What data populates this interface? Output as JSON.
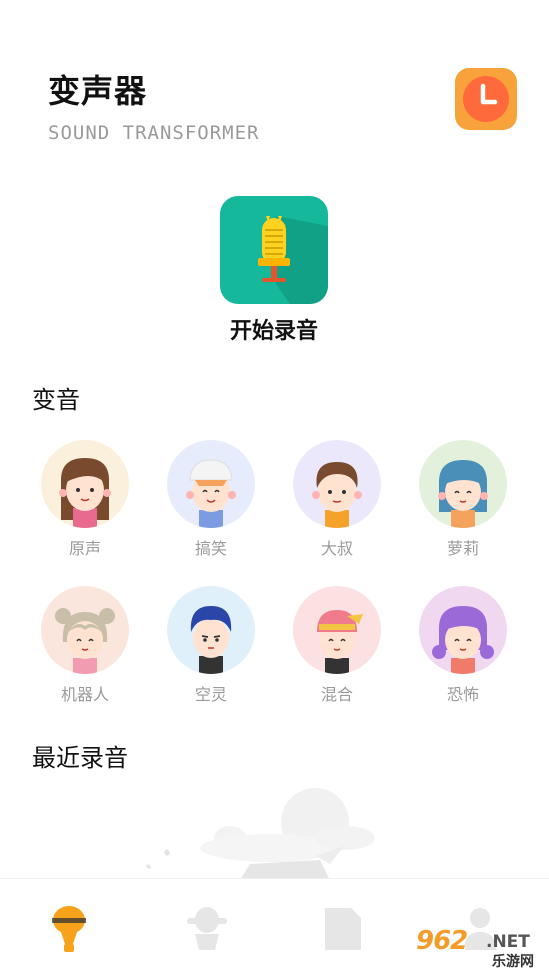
{
  "header": {
    "title": "变声器",
    "subtitle": "SOUND TRANSFORMER",
    "history_icon": "clock-icon"
  },
  "record": {
    "label": "开始录音",
    "icon": "microphone-icon"
  },
  "voice_section": {
    "title": "变音",
    "items": [
      {
        "label": "原声"
      },
      {
        "label": "搞笑"
      },
      {
        "label": "大叔"
      },
      {
        "label": "萝莉"
      },
      {
        "label": "机器人"
      },
      {
        "label": "空灵"
      },
      {
        "label": "混合"
      },
      {
        "label": "恐怖"
      }
    ]
  },
  "recent_section": {
    "title": "最近录音"
  },
  "tabbar": {
    "tabs": [
      {
        "icon": "microphone-tab-icon",
        "active": true
      },
      {
        "icon": "voice-chat-tab-icon",
        "active": false
      },
      {
        "icon": "file-tab-icon",
        "active": false
      },
      {
        "icon": "profile-tab-icon",
        "active": false
      }
    ]
  },
  "watermark": {
    "brand": "962",
    "suffix": ".NET",
    "site": "乐游网"
  },
  "colors": {
    "accent": "#f7a23a",
    "record_green": "#15b89a",
    "muted_text": "#9a9a9a"
  }
}
